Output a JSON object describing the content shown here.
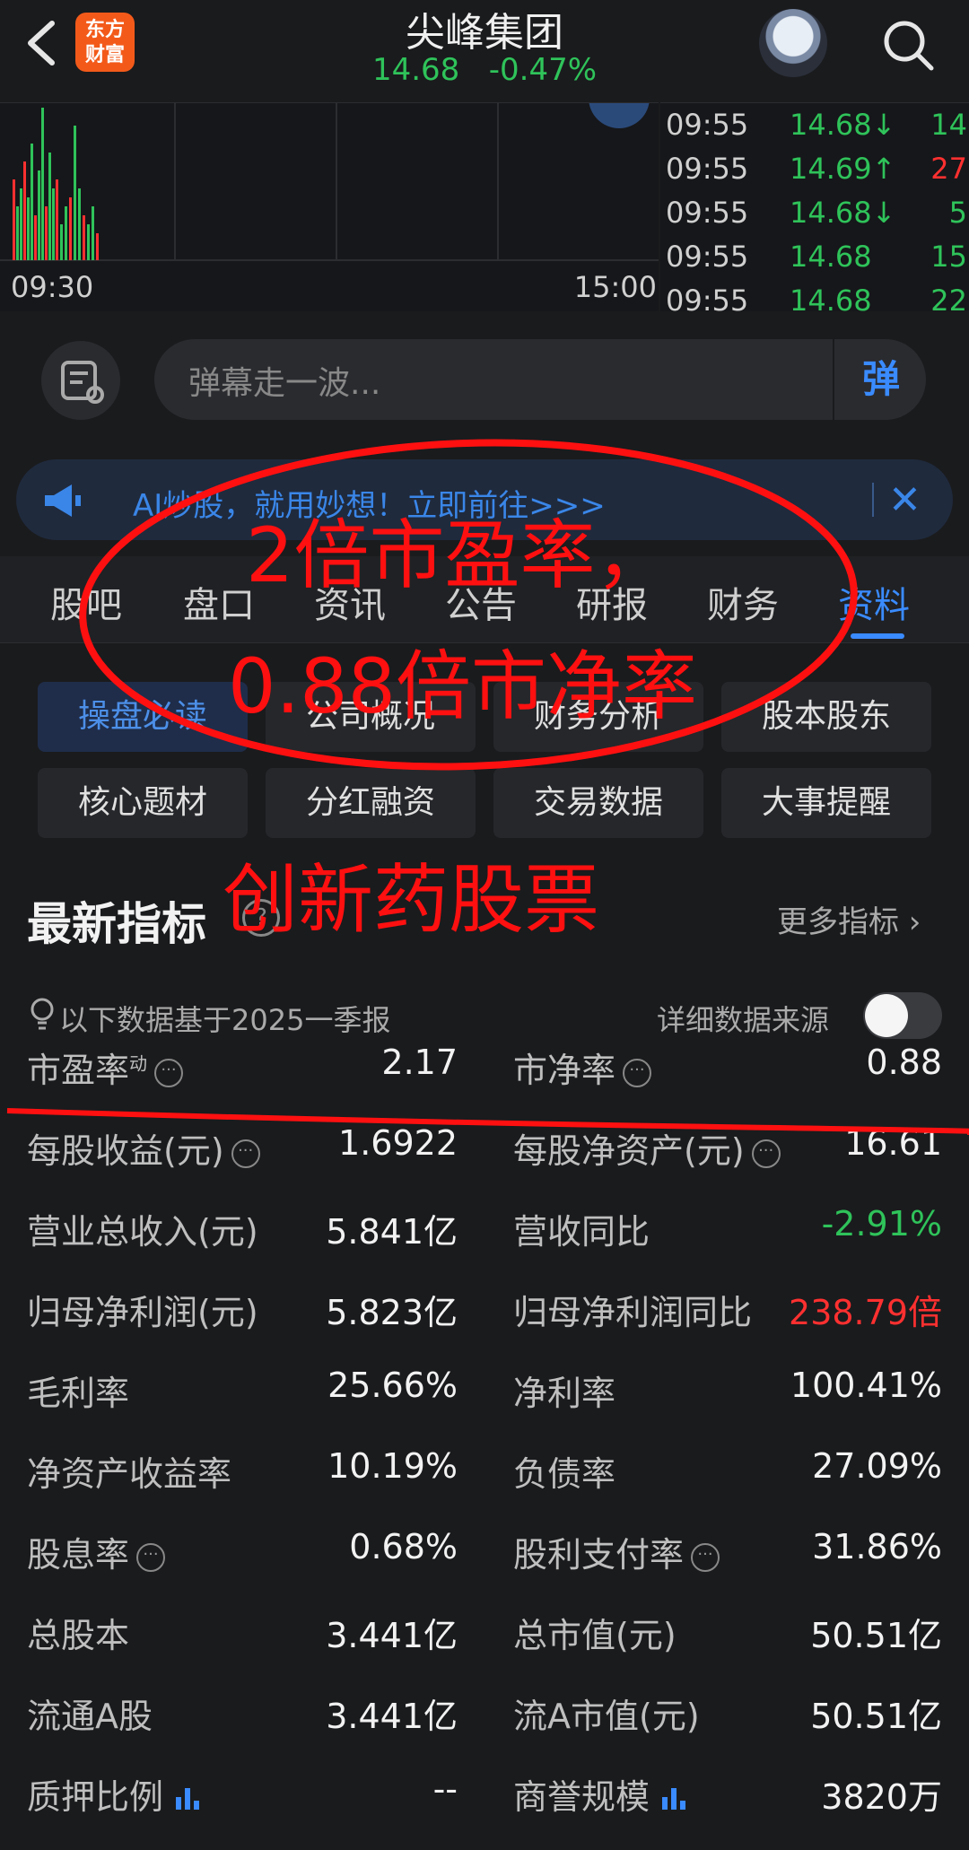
{
  "header": {
    "logo_text_line1": "东方",
    "logo_text_line2": "财富",
    "stock_name": "尖峰集团",
    "price": "14.68",
    "change_pct": "-0.47%"
  },
  "chart": {
    "time_start": "09:30",
    "time_end": "15:00"
  },
  "ticks": [
    {
      "time": "09:55",
      "price": "14.68↓",
      "vol": "14",
      "price_color": "g",
      "vol_color": "g"
    },
    {
      "time": "09:55",
      "price": "14.69↑",
      "vol": "27",
      "price_color": "g",
      "vol_color": "r"
    },
    {
      "time": "09:55",
      "price": "14.68↓",
      "vol": "5",
      "price_color": "g",
      "vol_color": "g"
    },
    {
      "time": "09:55",
      "price": "14.68",
      "vol": "15",
      "price_color": "g",
      "vol_color": "g"
    },
    {
      "time": "09:55",
      "price": "14.68",
      "vol": "22",
      "price_color": "g",
      "vol_color": "g"
    }
  ],
  "danmu": {
    "placeholder": "弹幕走一波...",
    "send_label": "弹"
  },
  "banner": {
    "text": "AI炒股，就用妙想！立即前往>>>"
  },
  "tabs": [
    "股吧",
    "盘口",
    "资讯",
    "公告",
    "研报",
    "财务",
    "资料"
  ],
  "active_tab": "资料",
  "chips": [
    "操盘必读",
    "公司概况",
    "财务分析",
    "股本股东",
    "核心题材",
    "分红融资",
    "交易数据",
    "大事提醒"
  ],
  "section": {
    "title": "最新指标",
    "more": "更多指标 ›",
    "note": "以下数据基于2025一季报",
    "source_label": "详细数据来源"
  },
  "metrics": [
    {
      "l1": "市盈率",
      "l1_sup": "动",
      "l1_info": true,
      "v1": "2.17",
      "l2": "市净率",
      "l2_info": true,
      "v2": "0.88",
      "v2_color": "w"
    },
    {
      "l1": "每股收益(元)",
      "l1_info": true,
      "v1": "1.6922",
      "l2": "每股净资产(元)",
      "l2_info": true,
      "v2": "16.61",
      "v2_color": "w"
    },
    {
      "l1": "营业总收入(元)",
      "v1": "5.841亿",
      "l2": "营收同比",
      "v2": "-2.91%",
      "v2_color": "g"
    },
    {
      "l1": "归母净利润(元)",
      "v1": "5.823亿",
      "l2": "归母净利润同比",
      "v2": "238.79倍",
      "v2_color": "r"
    },
    {
      "l1": "毛利率",
      "v1": "25.66%",
      "l2": "净利率",
      "v2": "100.41%",
      "v2_color": "w"
    },
    {
      "l1": "净资产收益率",
      "v1": "10.19%",
      "l2": "负债率",
      "v2": "27.09%",
      "v2_color": "w"
    },
    {
      "l1": "股息率",
      "l1_info": true,
      "v1": "0.68%",
      "l2": "股利支付率",
      "l2_info": true,
      "v2": "31.86%",
      "v2_color": "w"
    },
    {
      "l1": "总股本",
      "v1": "3.441亿",
      "l2": "总市值(元)",
      "v2": "50.51亿",
      "v2_color": "w"
    },
    {
      "l1": "流通A股",
      "v1": "3.441亿",
      "l2": "流A市值(元)",
      "v2": "50.51亿",
      "v2_color": "w"
    },
    {
      "l1": "质押比例",
      "l1_bars": true,
      "v1": "--",
      "l2": "商誉规模",
      "l2_bars": true,
      "v2": "3820万",
      "v2_color": "w"
    }
  ],
  "annotations": {
    "line1": "2倍市盈率，",
    "line2": "0.88倍市净率",
    "line3": "创新药股票"
  },
  "colors": {
    "bg": "#1a1b1d",
    "green": "#2fc35a",
    "red": "#ff3030",
    "accent": "#3a8bff",
    "annotation": "#ff1010"
  }
}
